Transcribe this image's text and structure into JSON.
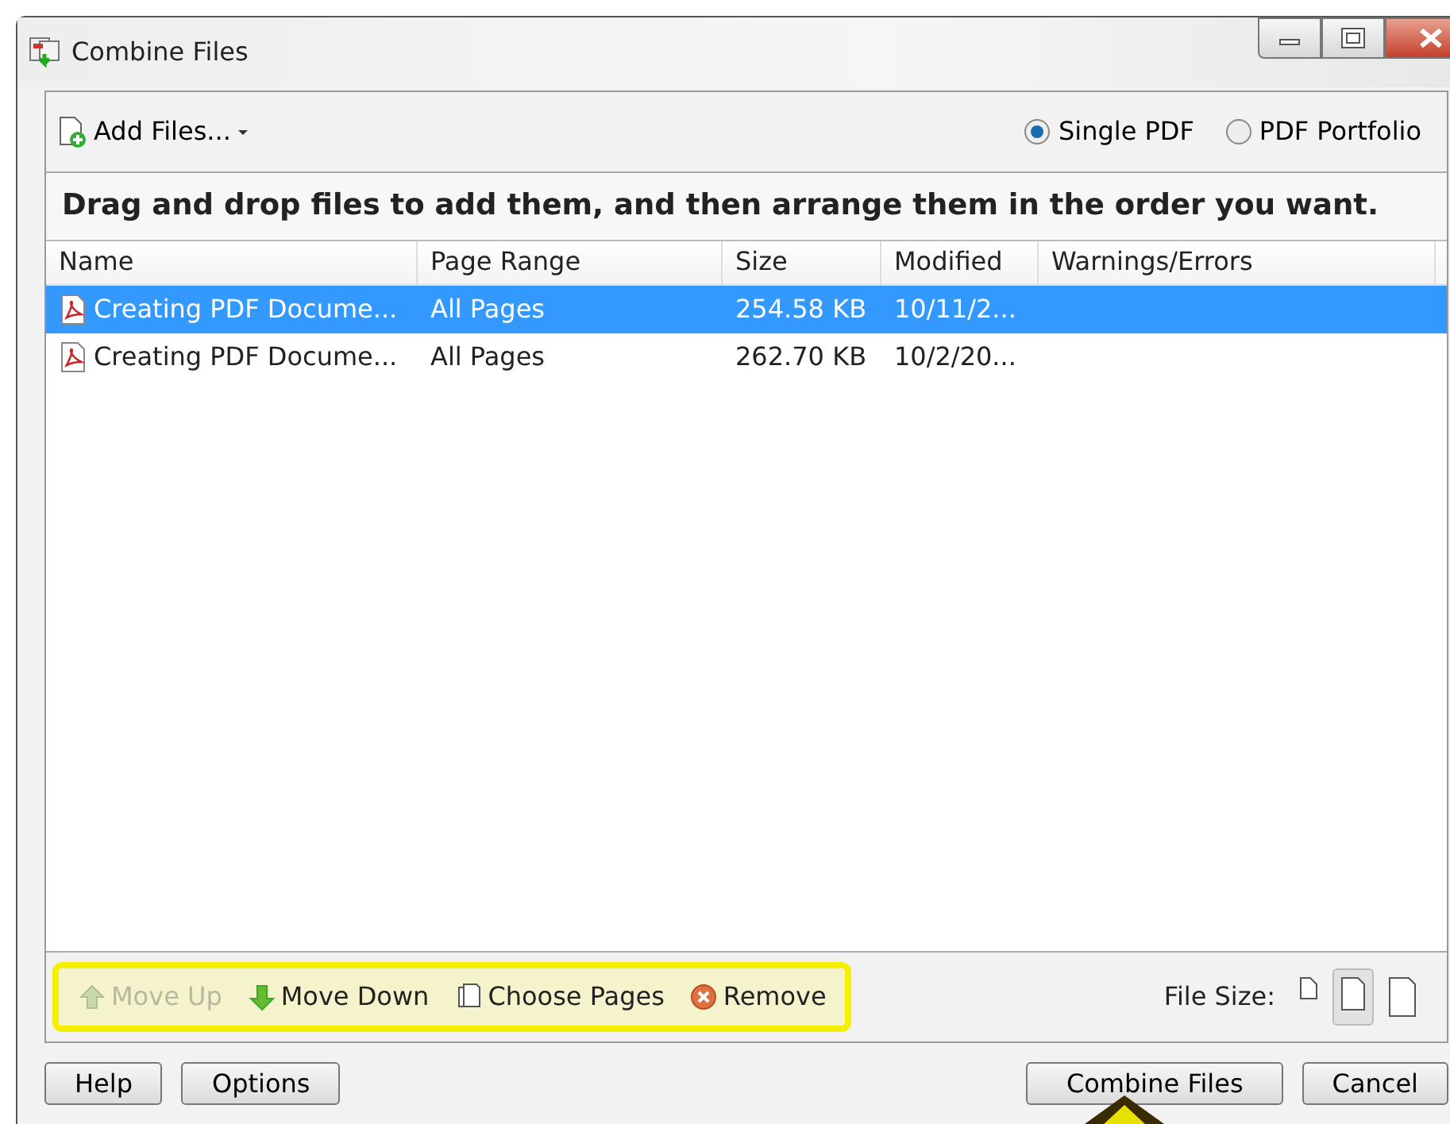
{
  "window": {
    "title": "Combine Files"
  },
  "add_files": {
    "label": "Add Files..."
  },
  "output_options": [
    {
      "label": "Single PDF",
      "selected": true
    },
    {
      "label": "PDF Portfolio",
      "selected": false
    }
  ],
  "instruction": "Drag and drop files to add them, and then arrange them in the order you want.",
  "table": {
    "columns": [
      "Name",
      "Page Range",
      "Size",
      "Modified",
      "Warnings/Errors"
    ],
    "rows": [
      {
        "name": "Creating PDF Docume...",
        "page_range": "All Pages",
        "size": "254.58 KB",
        "modified": "10/11/2...",
        "selected": true
      },
      {
        "name": "Creating PDF Docume...",
        "page_range": "All Pages",
        "size": "262.70 KB",
        "modified": "10/2/20...",
        "selected": false
      }
    ]
  },
  "actions": [
    {
      "kind": "up",
      "label": "Move Up",
      "disabled": true
    },
    {
      "kind": "down",
      "label": "Move Down",
      "disabled": false
    },
    {
      "kind": "pages",
      "label": "Choose Pages",
      "disabled": false
    },
    {
      "kind": "remove",
      "label": "Remove",
      "disabled": false
    }
  ],
  "file_size": {
    "label": "File Size:",
    "options": [
      {
        "kind": "small",
        "selected": false
      },
      {
        "kind": "medium",
        "selected": true
      },
      {
        "kind": "large",
        "selected": false
      }
    ]
  },
  "buttons_left": [
    "Help",
    "Options"
  ],
  "buttons_right": [
    "Combine Files",
    "Cancel"
  ]
}
